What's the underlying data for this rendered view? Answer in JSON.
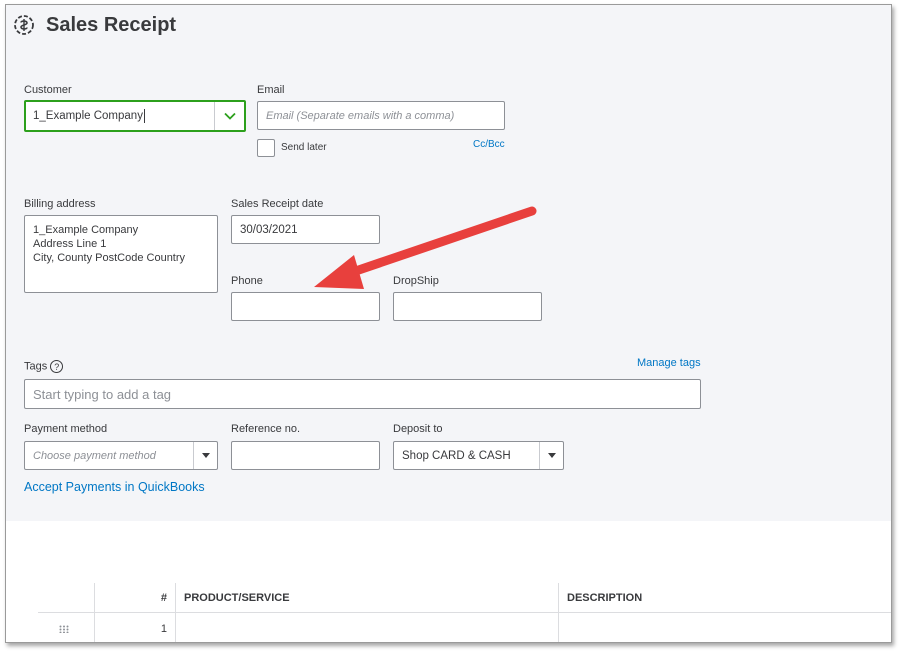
{
  "header": {
    "title": "Sales Receipt",
    "icon": "sales-receipt-icon"
  },
  "customer": {
    "label": "Customer",
    "value": "1_Example Company"
  },
  "email": {
    "label": "Email",
    "placeholder": "Email (Separate emails with a comma)",
    "send_later_label": "Send later",
    "cc_bcc_label": "Cc/Bcc"
  },
  "billing": {
    "label": "Billing address",
    "lines": [
      "1_Example Company",
      "Address Line 1",
      "City, County  PostCode Country"
    ]
  },
  "receipt_date": {
    "label": "Sales Receipt date",
    "value": "30/03/2021"
  },
  "phone": {
    "label": "Phone",
    "value": ""
  },
  "dropship": {
    "label": "DropShip",
    "value": ""
  },
  "tags": {
    "label": "Tags",
    "help": "?",
    "manage_label": "Manage tags",
    "placeholder": "Start typing to add a tag"
  },
  "payment_method": {
    "label": "Payment method",
    "placeholder": "Choose payment method"
  },
  "reference": {
    "label": "Reference no.",
    "value": ""
  },
  "deposit_to": {
    "label": "Deposit to",
    "value": "Shop CARD & CASH"
  },
  "accept_payments_link": "Accept Payments in QuickBooks",
  "table": {
    "columns": [
      "#",
      "PRODUCT/SERVICE",
      "DESCRIPTION"
    ],
    "rows": [
      {
        "num": "1"
      }
    ]
  },
  "colors": {
    "accent_green": "#2ca01c",
    "link_blue": "#0077c5",
    "arrow_red": "#e8403d",
    "panel_bg": "#f4f5f8"
  }
}
